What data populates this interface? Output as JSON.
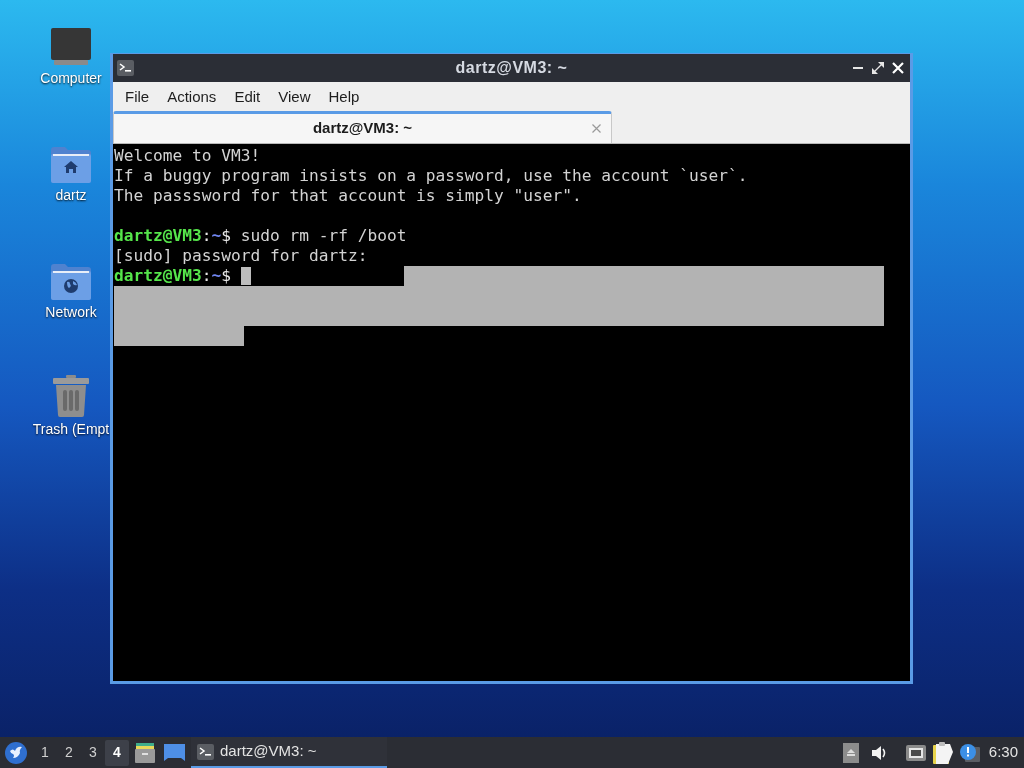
{
  "desktop_icons": [
    {
      "kind": "computer",
      "label": "Computer"
    },
    {
      "kind": "home_folder",
      "label": "dartz"
    },
    {
      "kind": "network_folder",
      "label": "Network"
    },
    {
      "kind": "trash",
      "label": "Trash (Empt"
    }
  ],
  "window": {
    "title": "dartz@VM3: ~",
    "menu": [
      "File",
      "Actions",
      "Edit",
      "View",
      "Help"
    ],
    "tabs": [
      {
        "label": "dartz@VM3: ~",
        "selected": true
      }
    ],
    "terminal": {
      "lines": [
        {
          "kind": "output",
          "text": "Welcome to VM3!"
        },
        {
          "kind": "output",
          "text": "If a buggy program insists on a password, use the account `user`."
        },
        {
          "kind": "output",
          "text": "The passsword for that account is simply \"user\"."
        },
        {
          "kind": "blank"
        },
        {
          "kind": "prompt",
          "user_host": "dartz@VM3",
          "separator": ":",
          "path": "~",
          "symbol": "$",
          "command": "sudo rm -rf /boot",
          "cursor": false
        },
        {
          "kind": "output",
          "text": "[sudo] password for dartz:"
        },
        {
          "kind": "prompt",
          "user_host": "dartz@VM3",
          "separator": ":",
          "path": "~",
          "symbol": "$",
          "cursor": true
        }
      ]
    }
  },
  "taskbar": {
    "workspaces": [
      {
        "label": "1",
        "selected": false
      },
      {
        "label": "2",
        "selected": false
      },
      {
        "label": "3",
        "selected": false
      },
      {
        "label": "4",
        "selected": true
      }
    ],
    "tasks": [
      {
        "label": "dartz@VM3: ~",
        "selected": true
      }
    ],
    "clock": "6:30"
  }
}
